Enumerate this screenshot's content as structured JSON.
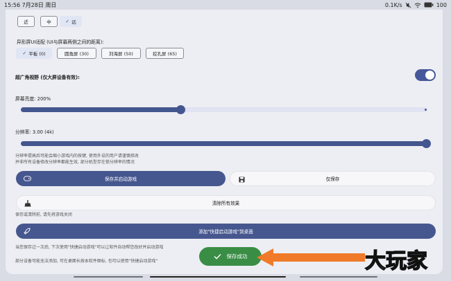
{
  "status_bar": {
    "time_date": "15:56 7月28日 周日",
    "net_speed": "0.1K/s",
    "battery": "100"
  },
  "distance": {
    "options": [
      "近",
      "中",
      "远"
    ],
    "selected": "远"
  },
  "notch": {
    "title": "异形屏UI适配 (UI与屏幕两侧之间的距离):",
    "options": [
      "平板 (0)",
      "圆角屏 (30)",
      "刘海屏 (50)",
      "挖孔屏 (65)"
    ],
    "selected": "平板 (0)"
  },
  "ultrawide": {
    "label": "超广角视野 (仅大屏设备有效):",
    "enabled": true
  },
  "brightness": {
    "label": "屏幕亮度: 200%",
    "value_percent": 200,
    "slider_fraction": 0.39
  },
  "resolution": {
    "label": "分辨率: 3.00 (4k)",
    "slider_fraction": 1.0,
    "note_line1": "分辨率提高后可能会缩小游戏内的按键, 使用外设的用户请谨慎修改",
    "note_line2": "并非所有设备修改分辨率都能生效, 部分机型存在锁分辨率的情况"
  },
  "buttons": {
    "save_and_start": "保存并启动游戏",
    "save_only": "仅保存",
    "clear_all": "清除所有效果",
    "clear_note": "保存或清除前, 请先将游戏关闭",
    "add_shortcut": "添加\"快捷启动游戏\"到桌面"
  },
  "footer": {
    "note1": "当您保存过一次后, 下次使用\"快捷启动游戏\"可以让软件自动帮您改好并启动游戏",
    "note2": "部分设备可能无法添加, 可在桌面长按本软件图标, 也可以使用\"快捷启动游戏\""
  },
  "toast": {
    "text": "保存成功"
  },
  "watermark": "大玩家",
  "colors": {
    "accent": "#46578f",
    "toast": "#3a8d45",
    "arrow": "#f07a2a"
  }
}
